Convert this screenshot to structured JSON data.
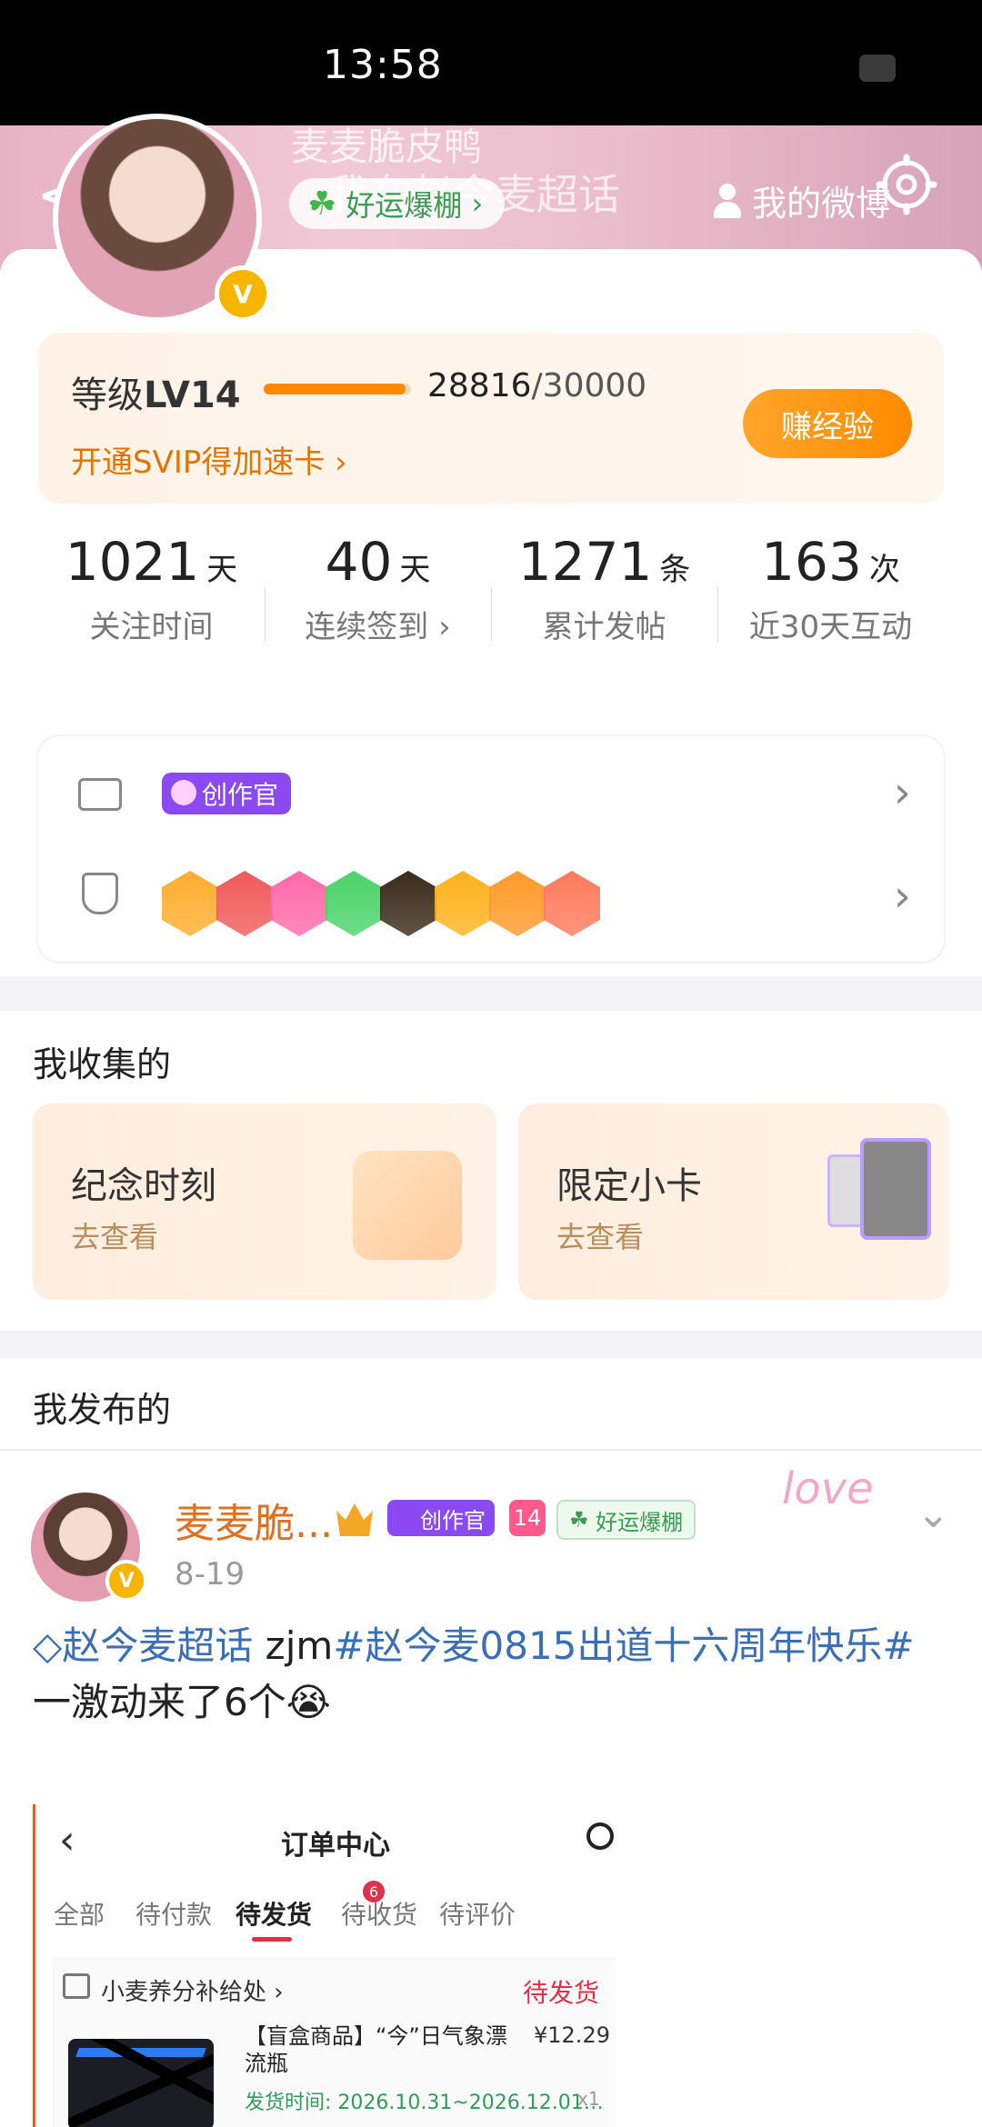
{
  "status_bar": {
    "time": "13:58"
  },
  "header": {
    "name_overlay": "麦麦脆皮鸭",
    "sub_overlay": "我在赵今麦超话",
    "luck_label": "好运爆棚",
    "my_weibo": "我的微博"
  },
  "level": {
    "prefix": "等级",
    "level": "LV14",
    "current": "28816",
    "max": "/30000",
    "progress": 0.96,
    "svip_link": "开通SVIP得加速卡",
    "earn_button": "赚经验"
  },
  "stats": [
    {
      "value": "1021",
      "unit": "天",
      "label": "关注时间"
    },
    {
      "value": "40",
      "unit": "天",
      "label": "连续签到"
    },
    {
      "value": "1271",
      "unit": "条",
      "label": "累计发帖"
    },
    {
      "value": "163",
      "unit": "次",
      "label": "近30天互动"
    }
  ],
  "badges": {
    "creator_tag": "创作官",
    "medal_colors": [
      "#ffad2e",
      "#f05a5a",
      "#ff6aa8",
      "#4cd36a",
      "#3a2a1a",
      "#ffb21c",
      "#ff9a2a",
      "#ff7a5c"
    ]
  },
  "collect": {
    "title": "我收集的",
    "cards": [
      {
        "title": "纪念时刻",
        "sub": "去查看"
      },
      {
        "title": "限定小卡",
        "sub": "去查看"
      }
    ]
  },
  "published": {
    "title": "我发布的",
    "post": {
      "name": "麦麦脆...",
      "time": "8-19",
      "creator_tag": "创作官",
      "level_tag": "14",
      "luck_tag": "好运爆棚",
      "topic1": "赵今麦超话",
      "text_mid": " zjm",
      "topic2": "#赵今麦0815出道十六周年快乐#",
      "line2": "一激动来了6个😭",
      "deco": "love"
    }
  },
  "embed": {
    "title": "订单中心",
    "tabs": [
      "全部",
      "待付款",
      "待发货",
      "待收货",
      "待评价"
    ],
    "tab_badge": "6",
    "shop_name": "小麦养分补给处",
    "status": "待发货",
    "item_title": "【盲盒商品】“今”日气象漂流瓶",
    "price": "¥12.29",
    "ship_time": "发货时间: 2026.10.31~2026.12.01…",
    "qty": "x1"
  }
}
